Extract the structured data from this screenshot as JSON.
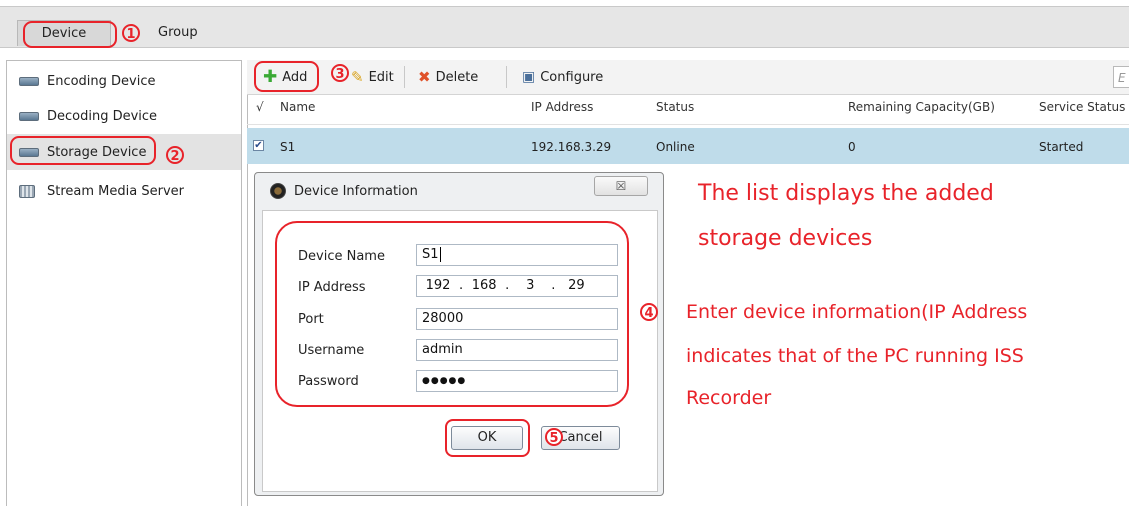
{
  "tabs": {
    "device": "Device",
    "group": "Group"
  },
  "sidebar": {
    "items": [
      {
        "label": "Encoding Device"
      },
      {
        "label": "Decoding Device"
      },
      {
        "label": "Storage Device"
      },
      {
        "label": "Stream Media Server"
      }
    ]
  },
  "toolbar": {
    "add": "Add",
    "edit": "Edit",
    "delete": "Delete",
    "configure": "Configure",
    "search_placeholder": "E"
  },
  "table": {
    "check_header": "√",
    "columns": [
      "Name",
      "IP Address",
      "Status",
      "Remaining Capacity(GB)",
      "Service Status"
    ],
    "rows": [
      {
        "checked": true,
        "name": "S1",
        "ip": "192.168.3.29",
        "status": "Online",
        "capacity": "0",
        "service": "Started"
      }
    ]
  },
  "dialog": {
    "title": "Device Information",
    "close": "☒",
    "fields": {
      "device_name_label": "Device Name",
      "device_name_value": "S1",
      "ip_label": "IP Address",
      "ip_octets": [
        "192",
        "168",
        "3",
        "29"
      ],
      "port_label": "Port",
      "port_value": "28000",
      "username_label": "Username",
      "username_value": "admin",
      "password_label": "Password",
      "password_value": "●●●●●"
    },
    "ok": "OK",
    "cancel": "Cancel"
  },
  "annotations": {
    "steps": [
      "1",
      "2",
      "3",
      "4",
      "5"
    ],
    "list_note_line1": "The list displays the added",
    "list_note_line2": "storage devices",
    "info_note_line1": "Enter device information(IP Address",
    "info_note_line2": "indicates that of the PC running ISS",
    "info_note_line3": "Recorder",
    "accent_color": "#e8232a"
  }
}
